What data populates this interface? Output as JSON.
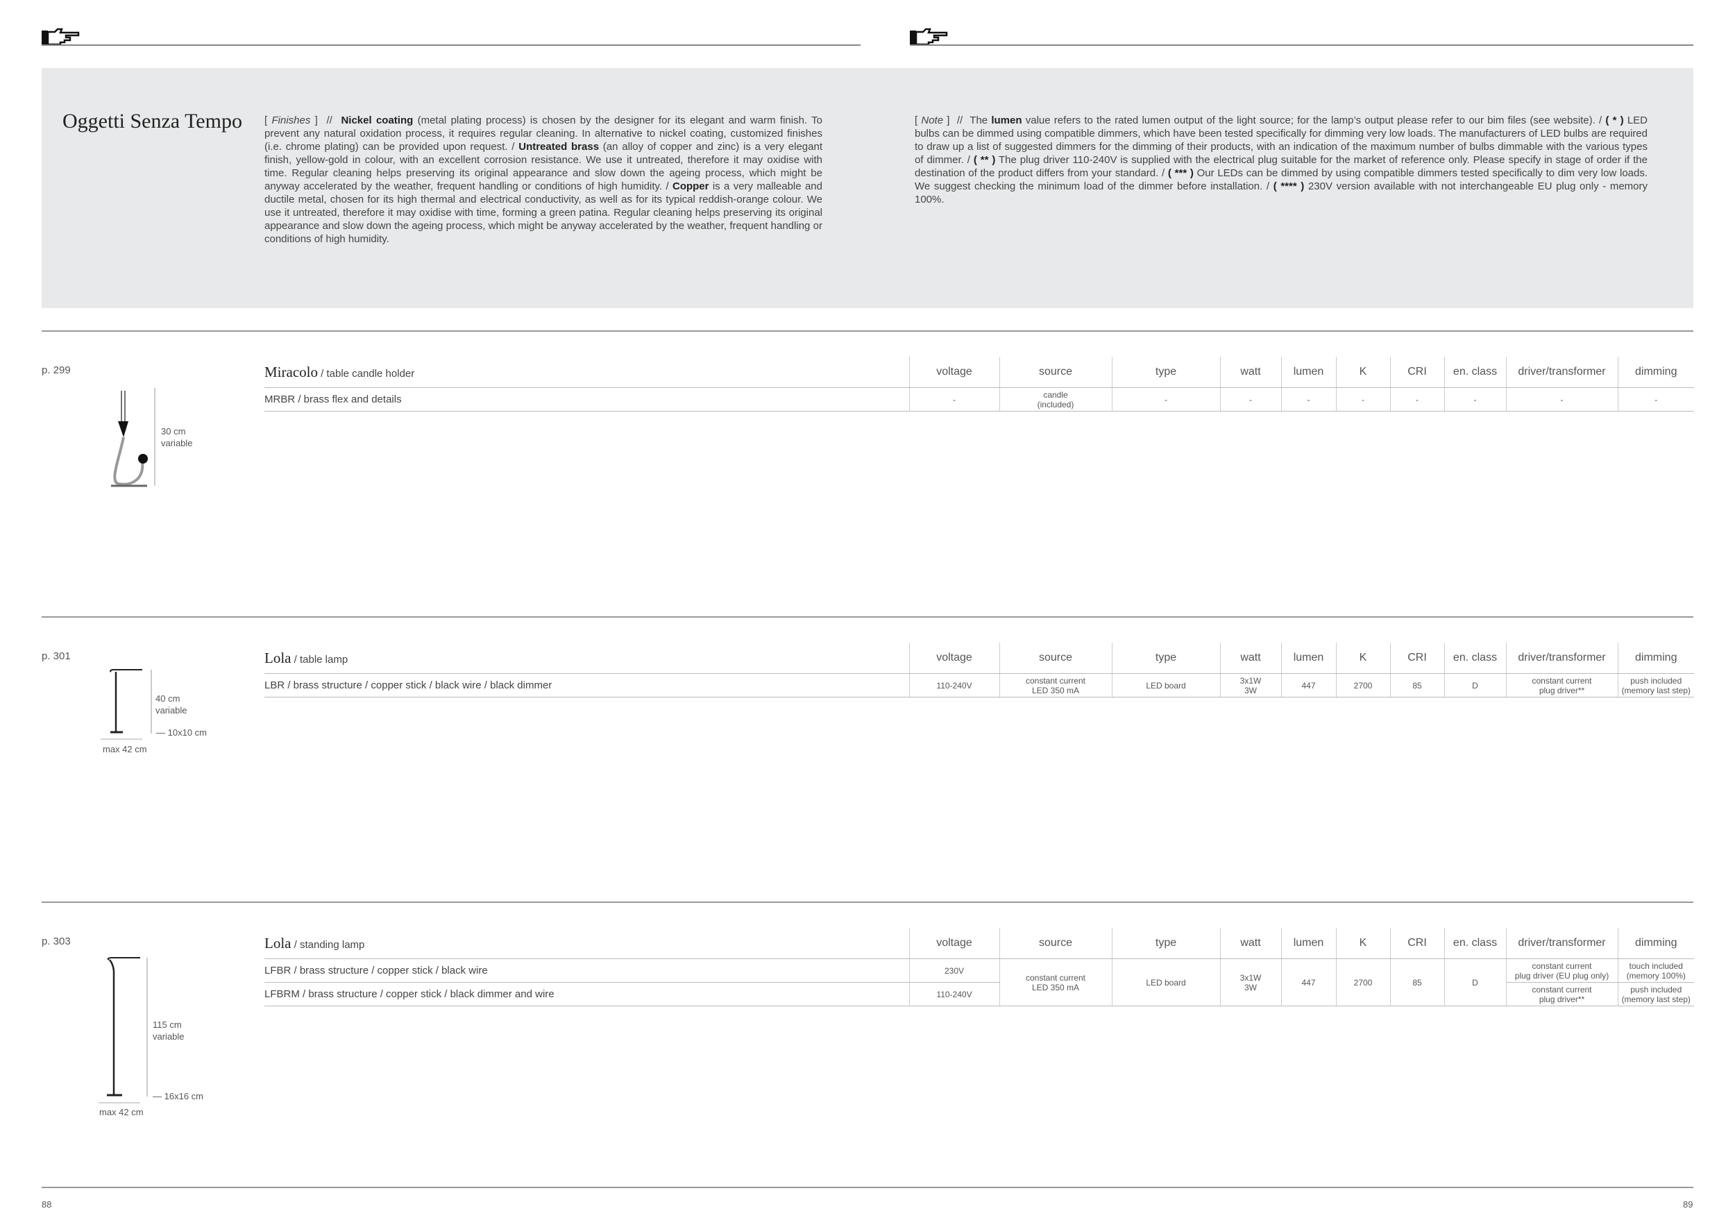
{
  "intro": {
    "brand": "Oggetti Senza Tempo",
    "finishes": {
      "label": "Finishes",
      "sep": "//",
      "nickel_title": "Nickel coating",
      "nickel_text": " (metal plating process) is chosen by the designer for its elegant and warm finish. To prevent any natural oxidation process, it requires regular cleaning. In alternative to nickel coating, customized finishes (i.e. chrome plating) can be provided upon request. / ",
      "brass_title": "Untreated brass",
      "brass_text": " (an alloy of copper and zinc) is a very elegant finish, yellow-gold in colour, with an excellent corrosion resistance. We use it untreated, therefore it may oxidise with time. Regular cleaning helps preserving its original appearance and slow down the ageing process, which might be anyway accelerated by the weather, frequent handling or conditions of high humidity. / ",
      "copper_title": "Copper",
      "copper_text": " is a very malleable and ductile metal, chosen for its high thermal and electrical conductivity, as well as for its typical reddish-orange colour. We use it untreated, therefore it may oxidise with time, forming a green patina. Regular cleaning helps preserving its original appearance and slow down the ageing process, which might be anyway accelerated by the weather, frequent handling or conditions of high humidity."
    },
    "note": {
      "label": "Note",
      "sep": "//",
      "t1": "The ",
      "lumen": "lumen",
      "t2": " value refers to the rated lumen output of the light source; for the lamp’s output please refer to our bim files (see website). / ",
      "m1": "( * )",
      "t3": " LED bulbs can be dimmed using compatible dimmers, which have been tested specifically for dimming very low loads. The manufacturers of LED bulbs are required to draw up a list of suggested dimmers for the dimming of their products, with an indication of the maximum number of bulbs dimmable with the various types of dimmer. / ",
      "m2": "( ** )",
      "t4": " The plug driver 110-240V is supplied with the electrical plug suitable for the market of reference only. Please specify in stage of order if the destination of the product differs from your standard. / ",
      "m3": "( *** )",
      "t5": " Our LEDs can be dimmed by using compatible dimmers tested specifically to dim very low loads. We suggest checking the minimum load of the dimmer before installation. / ",
      "m4": "( **** )",
      "t6": " 230V version available with not interchangeable EU plug only - memory 100%."
    }
  },
  "columns": [
    "voltage",
    "source",
    "type",
    "watt",
    "lumen",
    "K",
    "CRI",
    "en. class",
    "driver/transformer",
    "dimming"
  ],
  "products": [
    {
      "page_ref": "p. 299",
      "name": "Miracolo",
      "kind": " / table candle holder",
      "dims": {
        "height": "30 cm",
        "height_note": "variable"
      },
      "rows": [
        {
          "code": "MRBR / brass flex and details",
          "voltage": "-",
          "source_l1": "candle",
          "source_l2": "(included)",
          "type": "-",
          "watt_l1": "-",
          "watt_l2": "",
          "lumen": "-",
          "k": "-",
          "cri": "-",
          "en_class": "-",
          "driver_l1": "-",
          "driver_l2": "",
          "dimming_l1": "-",
          "dimming_l2": ""
        }
      ]
    },
    {
      "page_ref": "p. 301",
      "name": "Lola",
      "kind": " / table lamp",
      "dims": {
        "height": "40 cm",
        "height_note": "variable",
        "base": "10x10 cm",
        "max": "max 42 cm"
      },
      "rows": [
        {
          "code": "LBR / brass structure / copper stick / black wire / black dimmer",
          "voltage": "110-240V",
          "source_l1": "constant current",
          "source_l2": "LED 350 mA",
          "type": "LED board",
          "watt_l1": "3x1W",
          "watt_l2": "3W",
          "lumen": "447",
          "k": "2700",
          "cri": "85",
          "en_class": "D",
          "driver_l1": "constant current",
          "driver_l2": "plug driver**",
          "dimming_l1": "push included",
          "dimming_l2": "(memory last step)"
        }
      ]
    },
    {
      "page_ref": "p. 303",
      "name": "Lola",
      "kind": " / standing lamp",
      "dims": {
        "height": "115 cm",
        "height_note": "variable",
        "base": "16x16 cm",
        "max": "max 42 cm"
      },
      "shared": {
        "source_l1": "constant current",
        "source_l2": "LED 350 mA",
        "type": "LED board",
        "watt_l1": "3x1W",
        "watt_l2": "3W",
        "lumen": "447",
        "k": "2700",
        "cri": "85",
        "en_class": "D"
      },
      "rows": [
        {
          "code": "LFBR / brass structure / copper stick / black wire",
          "voltage": "230V",
          "driver_l1": "constant current",
          "driver_l2": "plug driver (EU plug only)",
          "dimming_l1": "touch included",
          "dimming_l2": "(memory 100%)"
        },
        {
          "code": "LFBRM / brass structure / copper stick / black dimmer and wire",
          "voltage": "110-240V",
          "driver_l1": "constant current",
          "driver_l2": "plug driver**",
          "dimming_l1": "push included",
          "dimming_l2": "(memory last step)"
        }
      ]
    }
  ],
  "footer": {
    "left_page": "88",
    "right_page": "89"
  }
}
